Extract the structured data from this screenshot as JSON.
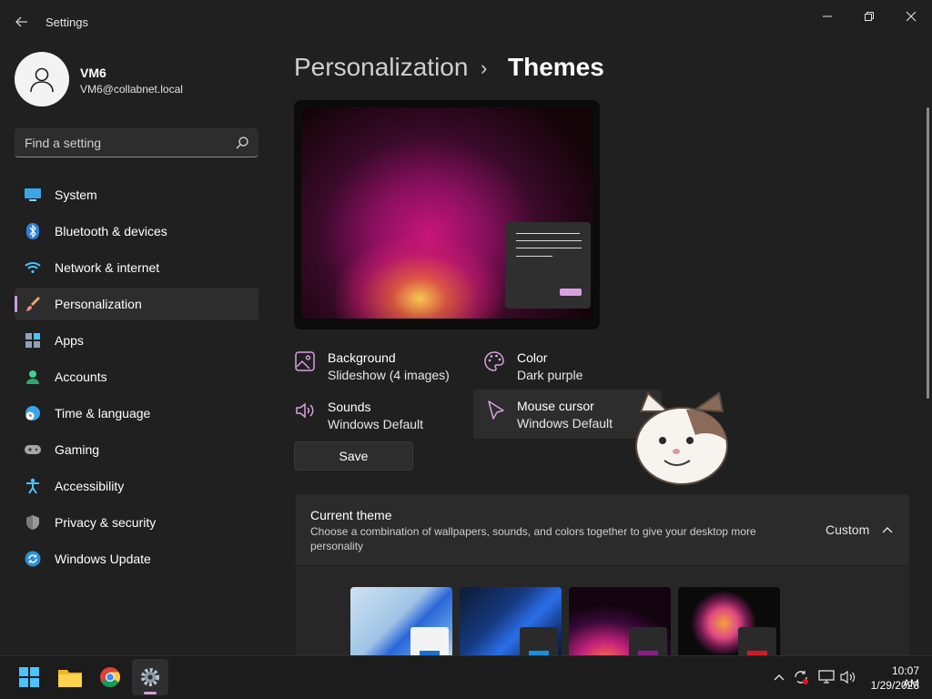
{
  "window": {
    "title": "Settings",
    "controls": [
      "minimize",
      "maximize",
      "close"
    ]
  },
  "user": {
    "name": "VM6",
    "email": "VM6@collabnet.local"
  },
  "search": {
    "placeholder": "Find a setting"
  },
  "sidebar": {
    "items": [
      {
        "label": "System",
        "icon": "system-icon",
        "selected": false
      },
      {
        "label": "Bluetooth & devices",
        "icon": "bluetooth-icon",
        "selected": false
      },
      {
        "label": "Network & internet",
        "icon": "wifi-icon",
        "selected": false
      },
      {
        "label": "Personalization",
        "icon": "brush-icon",
        "selected": true
      },
      {
        "label": "Apps",
        "icon": "apps-icon",
        "selected": false
      },
      {
        "label": "Accounts",
        "icon": "accounts-icon",
        "selected": false
      },
      {
        "label": "Time & language",
        "icon": "time-language-icon",
        "selected": false
      },
      {
        "label": "Gaming",
        "icon": "gamepad-icon",
        "selected": false
      },
      {
        "label": "Accessibility",
        "icon": "accessibility-icon",
        "selected": false
      },
      {
        "label": "Privacy & security",
        "icon": "shield-icon",
        "selected": false
      },
      {
        "label": "Windows Update",
        "icon": "update-icon",
        "selected": false
      }
    ]
  },
  "breadcrumb": {
    "parent": "Personalization",
    "separator": "›",
    "current": "Themes"
  },
  "theme_settings": {
    "background": {
      "title": "Background",
      "value": "Slideshow (4 images)"
    },
    "color": {
      "title": "Color",
      "value": "Dark purple"
    },
    "sounds": {
      "title": "Sounds",
      "value": "Windows Default"
    },
    "mouse_cursor": {
      "title": "Mouse cursor",
      "value": "Windows Default"
    }
  },
  "save_label": "Save",
  "current_theme": {
    "title": "Current theme",
    "description": "Choose a combination of wallpapers, sounds, and colors together to give your desktop more personality",
    "value": "Custom",
    "expanded": true
  },
  "colors": {
    "accent": "#d7a0de",
    "selection_bar": "#c79ee6",
    "background": "#202020",
    "card": "#2b2b2b"
  },
  "taskbar": {
    "apps": [
      "start-icon",
      "file-explorer-icon",
      "chrome-icon",
      "settings-icon"
    ],
    "active_app": "settings-icon",
    "tray": [
      "chevron-up-icon",
      "sync-icon",
      "network-icon",
      "volume-icon"
    ],
    "time": "10:07 AM",
    "date": "1/29/2023"
  }
}
